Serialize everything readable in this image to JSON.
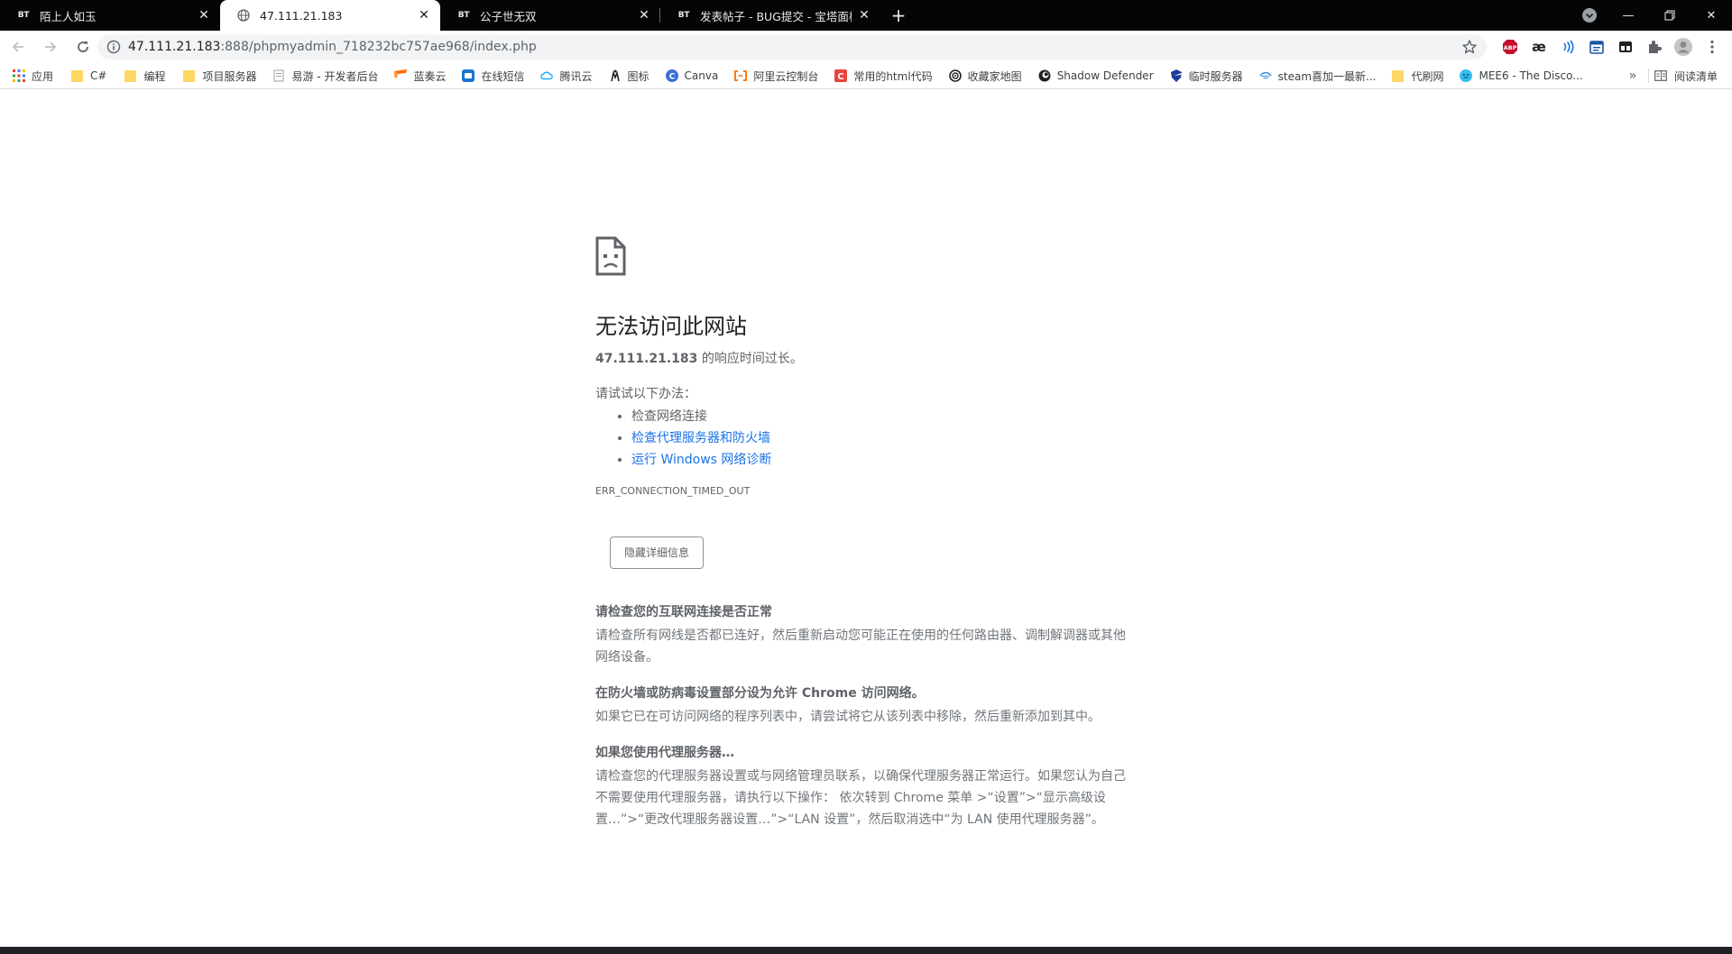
{
  "tabs": [
    {
      "favicon": "BT",
      "title": "陌上人如玉"
    },
    {
      "favicon": "globe-icon",
      "title": "47.111.21.183"
    },
    {
      "favicon": "BT",
      "title": "公子世无双"
    },
    {
      "favicon": "BT",
      "title": "发表帖子 - BUG提交 - 宝塔面板"
    }
  ],
  "address": {
    "host": "47.111.21.183",
    "rest": ":888/phpmyadmin_718232bc757ae968/index.php"
  },
  "extensions": [
    "ABP",
    "æ"
  ],
  "bookmarks": [
    {
      "label": "应用",
      "icon": "apps-icon"
    },
    {
      "label": "C#",
      "icon": "folder-icon"
    },
    {
      "label": "编程",
      "icon": "folder-icon"
    },
    {
      "label": "项目服务器",
      "icon": "folder-icon"
    },
    {
      "label": "易游 - 开发者后台",
      "icon": "page-icon"
    },
    {
      "label": "蓝奏云",
      "icon": "lanzou-icon"
    },
    {
      "label": "在线短信",
      "icon": "sms-icon"
    },
    {
      "label": "腾讯云",
      "icon": "cloud-icon"
    },
    {
      "label": "图标",
      "icon": "iconfont-icon"
    },
    {
      "label": "Canva",
      "icon": "canva-icon"
    },
    {
      "label": "阿里云控制台",
      "icon": "aliyun-icon"
    },
    {
      "label": "常用的html代码",
      "icon": "c-icon"
    },
    {
      "label": "收藏家地图",
      "icon": "target-icon"
    },
    {
      "label": "Shadow Defender",
      "icon": "shadow-icon"
    },
    {
      "label": "临时服务器",
      "icon": "shield-icon"
    },
    {
      "label": "steam喜加一最新...",
      "icon": "steam-icon"
    },
    {
      "label": "代刷网",
      "icon": "folder-icon"
    },
    {
      "label": "MEE6 - The Disco...",
      "icon": "mee6-icon"
    }
  ],
  "reading_list": "阅读清单",
  "error": {
    "title": "无法访问此网站",
    "host": "47.111.21.183",
    "desc_suffix": " 的响应时间过长。",
    "try_label": "请试试以下办法：",
    "suggestions": [
      {
        "text": "检查网络连接",
        "link": false
      },
      {
        "text": "检查代理服务器和防火墙",
        "link": true
      },
      {
        "text": "运行 Windows 网络诊断",
        "link": true
      }
    ],
    "code": "ERR_CONNECTION_TIMED_OUT",
    "details_button": "隐藏详细信息",
    "details": [
      {
        "heading": "请检查您的互联网连接是否正常",
        "body": "请检查所有网线是否都已连好，然后重新启动您可能正在使用的任何路由器、调制解调器或其他网络设备。"
      },
      {
        "heading": "在防火墙或防病毒设置部分设为允许 Chrome 访问网络。",
        "body": "如果它已在可访问网络的程序列表中，请尝试将它从该列表中移除，然后重新添加到其中。"
      },
      {
        "heading": "如果您使用代理服务器…",
        "body": "请检查您的代理服务器设置或与网络管理员联系，以确保代理服务器正常运行。如果您认为自己不需要使用代理服务器，请执行以下操作： 依次转到 Chrome 菜单 >“设置”>“显示高级设置…”>“更改代理服务器设置…”>“LAN 设置”，然后取消选中“为 LAN 使用代理服务器”。"
      }
    ]
  }
}
